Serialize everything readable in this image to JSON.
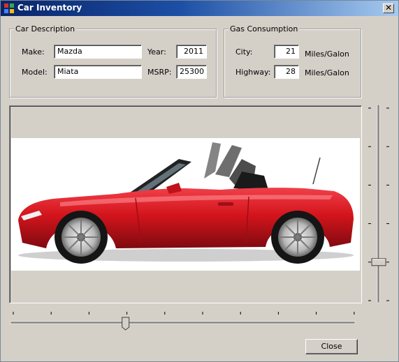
{
  "window": {
    "title": "Car Inventory"
  },
  "description": {
    "legend": "Car Description",
    "make_label": "Make:",
    "make_value": "Mazda",
    "model_label": "Model:",
    "model_value": "Miata",
    "year_label": "Year:",
    "year_value": "2011",
    "msrp_label": "MSRP:",
    "msrp_value": "25300"
  },
  "gas": {
    "legend": "Gas Consumption",
    "city_label": "City:",
    "city_value": "21",
    "city_unit": "Miles/Galon",
    "highway_label": "Highway:",
    "highway_value": "28",
    "highway_unit": "Miles/Galon"
  },
  "sliders": {
    "horizontal_level": 0.33,
    "vertical_level": 0.2
  },
  "image": {
    "subject": "red convertible sports car",
    "accent": "#d4141c"
  },
  "buttons": {
    "close_label": "Close"
  }
}
